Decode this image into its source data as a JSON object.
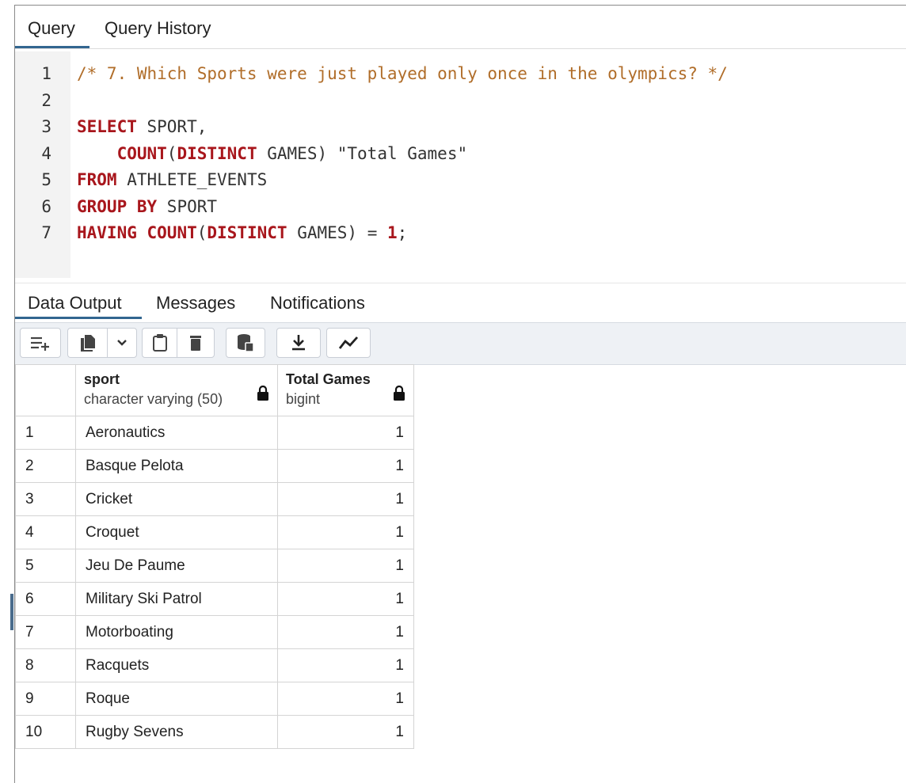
{
  "tabs": {
    "query": "Query",
    "history": "Query History"
  },
  "editor": {
    "lines": [
      {
        "n": "1",
        "parts": [
          {
            "t": "/* 7. Which Sports were just played only once in the olympics? */",
            "c": "cm"
          }
        ]
      },
      {
        "n": "2",
        "parts": []
      },
      {
        "n": "3",
        "parts": [
          {
            "t": "SELECT",
            "c": "kw"
          },
          {
            "t": " SPORT,",
            "c": "tx"
          }
        ]
      },
      {
        "n": "4",
        "parts": [
          {
            "t": "    ",
            "c": "tx"
          },
          {
            "t": "COUNT",
            "c": "kw"
          },
          {
            "t": "(",
            "c": "tx"
          },
          {
            "t": "DISTINCT",
            "c": "kw"
          },
          {
            "t": " GAMES) \"Total Games\"",
            "c": "tx"
          }
        ]
      },
      {
        "n": "5",
        "parts": [
          {
            "t": "FROM",
            "c": "kw"
          },
          {
            "t": " ATHLETE_EVENTS",
            "c": "tx"
          }
        ]
      },
      {
        "n": "6",
        "parts": [
          {
            "t": "GROUP BY",
            "c": "kw"
          },
          {
            "t": " SPORT",
            "c": "tx"
          }
        ]
      },
      {
        "n": "7",
        "parts": [
          {
            "t": "HAVING",
            "c": "kw"
          },
          {
            "t": " ",
            "c": "tx"
          },
          {
            "t": "COUNT",
            "c": "kw"
          },
          {
            "t": "(",
            "c": "tx"
          },
          {
            "t": "DISTINCT",
            "c": "kw"
          },
          {
            "t": " GAMES) = ",
            "c": "tx"
          },
          {
            "t": "1",
            "c": "num"
          },
          {
            "t": ";",
            "c": "tx"
          }
        ]
      }
    ]
  },
  "output_tabs": {
    "data": "Data Output",
    "messages": "Messages",
    "notifications": "Notifications"
  },
  "toolbar": {
    "icons": [
      "add-row-icon",
      "copy-icon",
      "chevron-down-icon",
      "paste-icon",
      "delete-icon",
      "save-data-icon",
      "download-icon",
      "graph-icon"
    ]
  },
  "grid": {
    "columns": [
      {
        "name": "sport",
        "type": "character varying (50)"
      },
      {
        "name": "Total Games",
        "type": "bigint"
      }
    ],
    "rows": [
      {
        "n": "1",
        "sport": "Aeronautics",
        "total": "1"
      },
      {
        "n": "2",
        "sport": "Basque Pelota",
        "total": "1"
      },
      {
        "n": "3",
        "sport": "Cricket",
        "total": "1"
      },
      {
        "n": "4",
        "sport": "Croquet",
        "total": "1"
      },
      {
        "n": "5",
        "sport": "Jeu De Paume",
        "total": "1"
      },
      {
        "n": "6",
        "sport": "Military Ski Patrol",
        "total": "1"
      },
      {
        "n": "7",
        "sport": "Motorboating",
        "total": "1"
      },
      {
        "n": "8",
        "sport": "Racquets",
        "total": "1"
      },
      {
        "n": "9",
        "sport": "Roque",
        "total": "1"
      },
      {
        "n": "10",
        "sport": "Rugby Sevens",
        "total": "1"
      }
    ]
  },
  "colors": {
    "accent": "#326690",
    "keyword": "#a8161c",
    "comment": "#b06d29"
  }
}
